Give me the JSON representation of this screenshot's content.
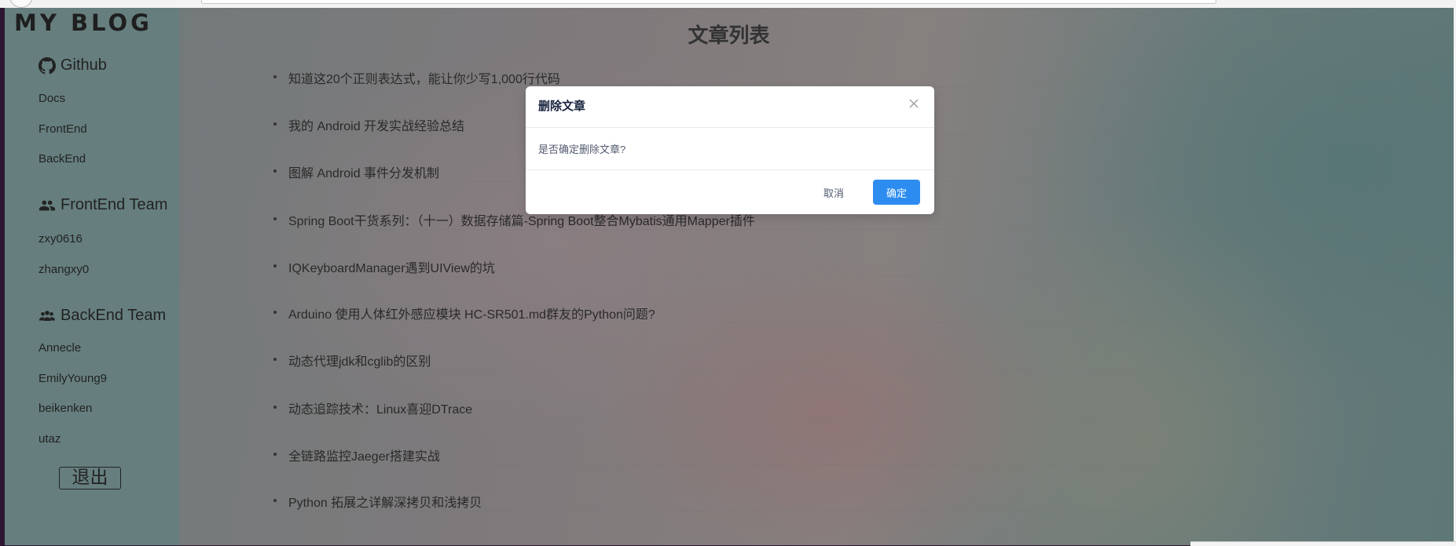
{
  "sidebar": {
    "brand": "MY BLOG",
    "sections": [
      {
        "title": "Github",
        "icon": "github-icon",
        "links": [
          "Docs",
          "FrontEnd",
          "BackEnd"
        ]
      },
      {
        "title": "FrontEnd Team",
        "icon": "people-icon",
        "links": [
          "zxy0616",
          "zhangxy0"
        ]
      },
      {
        "title": "BackEnd Team",
        "icon": "group-icon",
        "links": [
          "Annecle",
          "EmilyYoung9",
          "beikenken",
          "utaz"
        ]
      }
    ],
    "logout_label": "退出"
  },
  "main": {
    "title": "文章列表",
    "articles": [
      "知道这20个正则表达式，能让你少写1,000行代码",
      "我的 Android 开发实战经验总结",
      "图解 Android 事件分发机制",
      "Spring Boot干货系列：（十一）数据存储篇-Spring Boot整合Mybatis通用Mapper插件",
      "IQKeyboardManager遇到UIView的坑",
      "Arduino 使用人体红外感应模块 HC-SR501.md群友的Python问题?",
      "动态代理jdk和cglib的区别",
      "动态追踪技术：Linux喜迎DTrace",
      "全链路监控Jaeger搭建实战",
      "Python 拓展之详解深拷贝和浅拷贝"
    ]
  },
  "modal": {
    "title": "删除文章",
    "message": "是否确定删除文章?",
    "cancel_label": "取消",
    "confirm_label": "确定",
    "confirm_color": "#2d8cf0"
  }
}
